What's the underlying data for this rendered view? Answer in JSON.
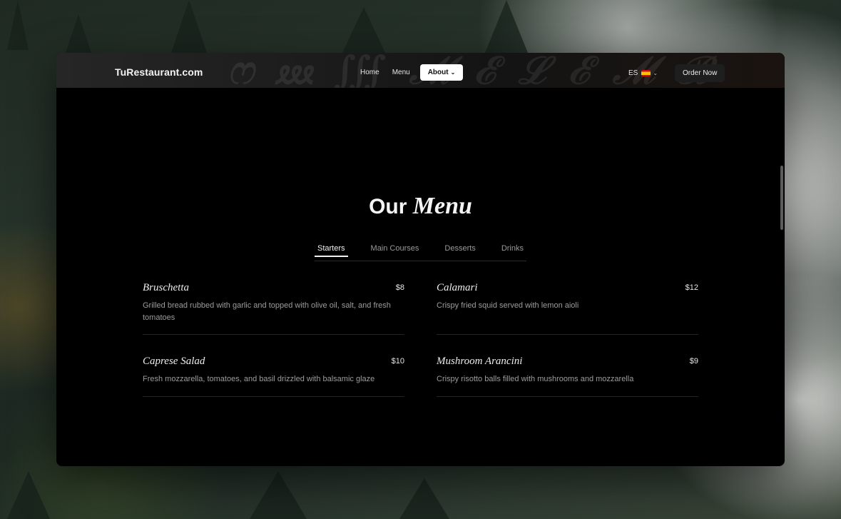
{
  "navbar": {
    "brand": "TuRestaurant.com",
    "links": [
      {
        "label": "Home"
      },
      {
        "label": "Menu"
      },
      {
        "label": "About"
      }
    ],
    "language": "ES",
    "order_button": "Order Now"
  },
  "menu_section": {
    "title_plain": "Our",
    "title_fancy": "Menu",
    "tabs": [
      "Starters",
      "Main Courses",
      "Desserts",
      "Drinks"
    ],
    "active_tab": "Starters",
    "items": [
      {
        "name": "Bruschetta",
        "price": "$8",
        "description": "Grilled bread rubbed with garlic and topped with olive oil, salt, and fresh tomatoes"
      },
      {
        "name": "Calamari",
        "price": "$12",
        "description": "Crispy fried squid served with lemon aioli"
      },
      {
        "name": "Caprese Salad",
        "price": "$10",
        "description": "Fresh mozzarella, tomatoes, and basil drizzled with balsamic glaze"
      },
      {
        "name": "Mushroom Arancini",
        "price": "$9",
        "description": "Crispy risotto balls filled with mushrooms and mozzarella"
      }
    ]
  },
  "colors": {
    "page_background": "#000000",
    "active_nav_background": "#ffffff",
    "text_primary": "#f4f4f4",
    "text_muted": "#9c9c9c"
  }
}
